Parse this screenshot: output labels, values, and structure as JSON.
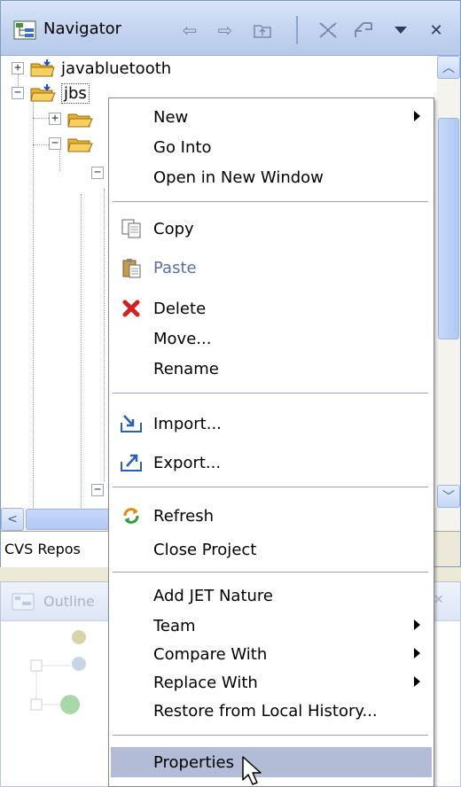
{
  "navigator": {
    "title": "Navigator",
    "tree": [
      {
        "label": "javabluetooth",
        "expander": "+"
      },
      {
        "label": "jbs",
        "expander": "−"
      }
    ],
    "bottom_tab": "CVS Repos"
  },
  "outline": {
    "title": "Outline"
  },
  "context_menu": {
    "items": [
      {
        "label": "New",
        "submenu": true
      },
      {
        "label": "Go Into"
      },
      {
        "label": "Open in New Window"
      },
      {
        "label": "Copy",
        "icon": "copy-icon"
      },
      {
        "label": "Paste",
        "icon": "paste-icon",
        "disabled": true
      },
      {
        "label": "Delete",
        "icon": "delete-icon"
      },
      {
        "label": "Move..."
      },
      {
        "label": "Rename"
      },
      {
        "label": "Import...",
        "icon": "import-icon"
      },
      {
        "label": "Export...",
        "icon": "export-icon"
      },
      {
        "label": "Refresh",
        "icon": "refresh-icon"
      },
      {
        "label": "Close Project"
      },
      {
        "label": "Add JET Nature"
      },
      {
        "label": "Team",
        "submenu": true
      },
      {
        "label": "Compare With",
        "submenu": true
      },
      {
        "label": "Replace With",
        "submenu": true
      },
      {
        "label": "Restore from Local History..."
      },
      {
        "label": "Properties",
        "highlighted": true
      }
    ]
  },
  "colors": {
    "header_gradient_top": "#d8e4f8",
    "menu_highlight": "#b3bcd6",
    "separator": "#9aa3c4",
    "disabled_text": "#5b6fa6"
  }
}
